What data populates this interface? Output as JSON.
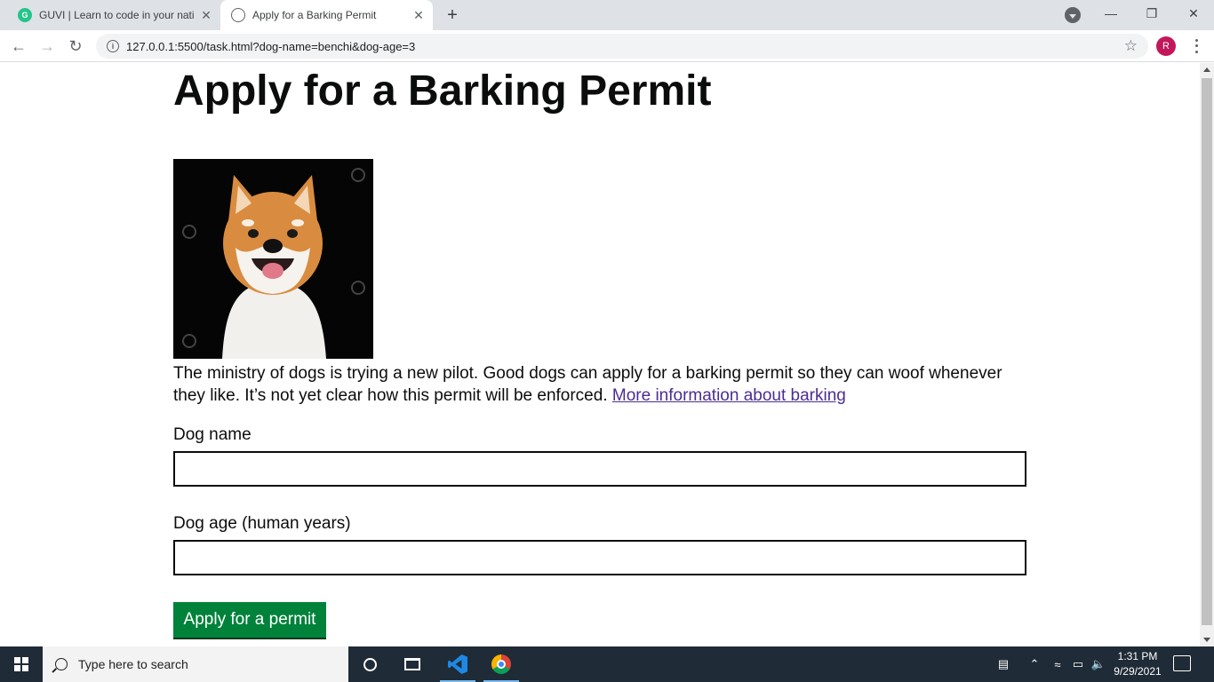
{
  "browser": {
    "tabs": [
      {
        "title": "GUVI | Learn to code in your nati",
        "favicon_text": "G",
        "active": false
      },
      {
        "title": "Apply for a Barking Permit",
        "active": true
      }
    ],
    "new_tab": "+",
    "url": "127.0.0.1:5500/task.html?dog-name=benchi&dog-age=3",
    "avatar_initial": "R"
  },
  "page": {
    "title": "Apply for a Barking Permit",
    "intro": "The ministry of dogs is trying a new pilot. Good dogs can apply for a barking permit so they can woof whenever they like. It’s not yet clear how this permit will be enforced.",
    "more_info_link": "More information about barking",
    "dog_name_label": "Dog name",
    "dog_name_value": "",
    "dog_age_label": "Dog age (human years)",
    "dog_age_value": "",
    "submit_label": "Apply for a permit"
  },
  "taskbar": {
    "search_placeholder": "Type here to search",
    "time": "1:31 PM",
    "date": "9/29/2021"
  },
  "colors": {
    "button_green": "#00823b",
    "link_purple": "#4c2c92",
    "avatar_bg": "#c2185b",
    "taskbar_bg": "#1f2b36"
  }
}
